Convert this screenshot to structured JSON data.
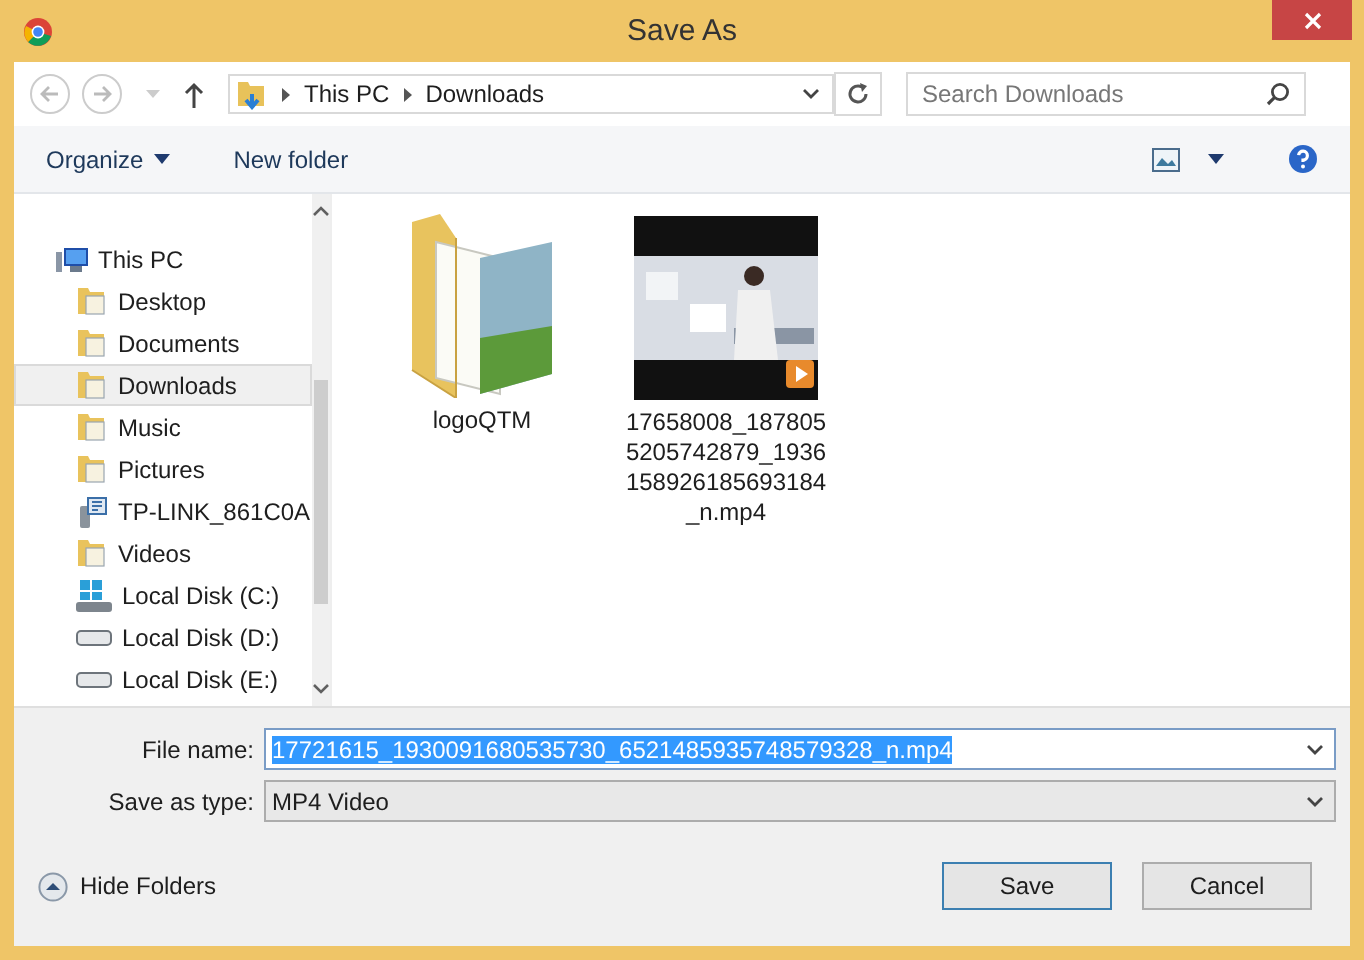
{
  "window": {
    "title": "Save As"
  },
  "nav": {
    "breadcrumb": [
      "This PC",
      "Downloads"
    ],
    "search": {
      "placeholder": "Search Downloads"
    }
  },
  "toolbar": {
    "organize": "Organize",
    "new_folder": "New folder"
  },
  "sidebar": {
    "items": [
      {
        "label": "This PC",
        "kind": "pc",
        "selected": false,
        "children": [
          {
            "label": "Desktop",
            "kind": "folder",
            "selected": false
          },
          {
            "label": "Documents",
            "kind": "folder",
            "selected": false
          },
          {
            "label": "Downloads",
            "kind": "folder",
            "selected": true
          },
          {
            "label": "Music",
            "kind": "folder",
            "selected": false
          },
          {
            "label": "Pictures",
            "kind": "folder",
            "selected": false
          },
          {
            "label": "TP-LINK_861C0A",
            "kind": "device",
            "selected": false
          },
          {
            "label": "Videos",
            "kind": "folder",
            "selected": false
          },
          {
            "label": "Local Disk (C:)",
            "kind": "system",
            "selected": false
          },
          {
            "label": "Local Disk (D:)",
            "kind": "drive",
            "selected": false
          },
          {
            "label": "Local Disk (E:)",
            "kind": "drive",
            "selected": false
          }
        ]
      }
    ]
  },
  "files": [
    {
      "name": "logoQTM",
      "kind": "folder"
    },
    {
      "name": "17658008_1878055205742879_1936158926185693184_n.mp4",
      "kind": "video"
    }
  ],
  "form": {
    "file_name": {
      "label": "File name:",
      "value": "17721615_1930091680535730_6521485935748579328_n.mp4",
      "selected": true
    },
    "type": {
      "label": "Save as type:",
      "value": "MP4 Video"
    }
  },
  "footer": {
    "hide_folders": "Hide Folders",
    "buttons": [
      {
        "label": "Save",
        "default": true
      },
      {
        "label": "Cancel",
        "default": false
      }
    ]
  }
}
